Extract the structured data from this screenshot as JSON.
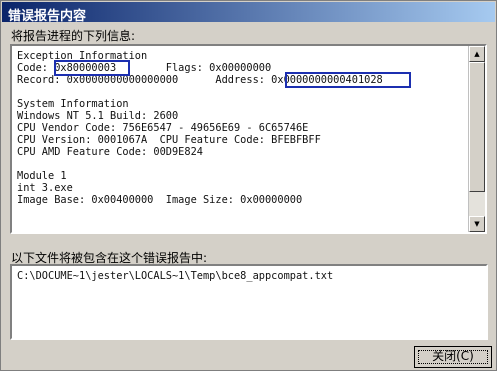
{
  "window": {
    "title": "错误报告内容"
  },
  "details": {
    "heading": "将报告进程的下列信息:",
    "lines": [
      "Exception Information",
      "Code: 0x80000003        Flags: 0x00000000",
      "Record: 0x0000000000000000      Address: 0x0000000000401028",
      "",
      "System Information",
      "Windows NT 5.1 Build: 2600",
      "CPU Vendor Code: 756E6547 - 49656E69 - 6C65746E",
      "CPU Version: 0001067A  CPU Feature Code: BFEBFBFF",
      "CPU AMD Feature Code: 00D9E824",
      "",
      "Module 1",
      "int 3.exe",
      "Image Base: 0x00400000  Image Size: 0x00000000"
    ],
    "highlights": [
      "0x80000003",
      "0x0000000000401028"
    ]
  },
  "files": {
    "heading": "以下文件将被包含在这个错误报告中:",
    "path": "C:\\DOCUME~1\\jester\\LOCALS~1\\Temp\\bce8_appcompat.txt"
  },
  "close_button": {
    "label": "关闭(C)"
  }
}
